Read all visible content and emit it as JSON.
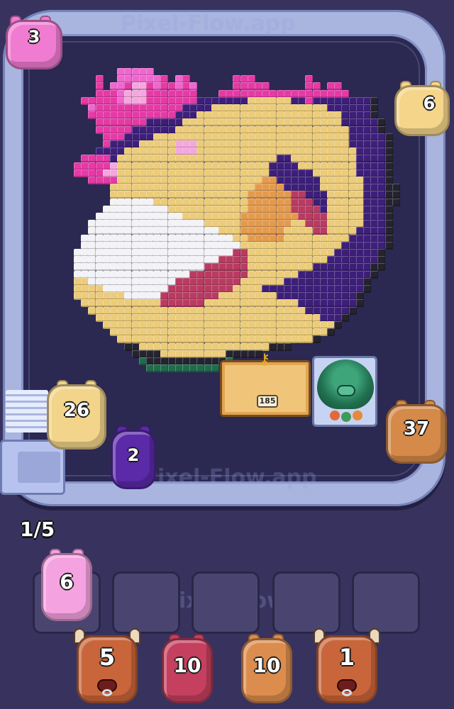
{
  "game": {
    "watermark_text": "Pixel-Flow.app",
    "queue_counter": "1/5",
    "key_box_count": "185"
  },
  "colors": {
    "background": "#38335e",
    "track": "#a9b5df",
    "board": "#2b2851"
  },
  "track_pigs": [
    {
      "name": "track-pig-pink",
      "number": "3",
      "color": "#f07cd2"
    },
    {
      "name": "track-pig-cream-right",
      "number": "6",
      "color": "#f4d58a"
    },
    {
      "name": "track-pig-cream-left",
      "number": "26",
      "color": "#f2d48a"
    },
    {
      "name": "track-pig-purple",
      "number": "2",
      "color": "#5a2aa8"
    },
    {
      "name": "track-pig-orange",
      "number": "37",
      "color": "#d58a4a"
    }
  ],
  "slot_pig": {
    "number": "6",
    "color": "#f5a2e0"
  },
  "bottom_pigs": [
    {
      "type": "bull",
      "number": "5",
      "color": "#c9653a"
    },
    {
      "type": "pig",
      "number": "10",
      "color": "#c4405e"
    },
    {
      "type": "pig",
      "number": "10",
      "color": "#dc8d4e"
    },
    {
      "type": "bull",
      "number": "1",
      "color": "#c9653a"
    }
  ],
  "slots": 5,
  "pixel_palette": {
    "p": "#f066cf",
    "P": "#e53aa6",
    "l": "#f4a7dd",
    "v": "#6a2fb0",
    "V": "#3d1f7a",
    "y": "#f6e39a",
    "Y": "#eccc7a",
    "w": "#f3f3f7",
    "o": "#e49a4d",
    "r": "#b93b62",
    "k": "#252330",
    "g": "#1e6c4a",
    "R": "#7a2a4c"
  },
  "pixel_art": [
    "......ppppp.....................................",
    "...P..ppppppP.pP......PPP.......P..............",
    "...P.ppPllPpPPpPp.....PPPPP.....PP.PP..........",
    "...PPPplllPPPPPPP...PPPPPPPPPPPPPPPPPP.........",
    ".PPPPPplllPPPPPPPVVVVVVVYYYYYYVVPVVVVVVVVk.....",
    "..pPPPPPPPPPPPPVVVVYYYYYYYYYYYYYYYYVVVVVVk.....",
    "..PPPPPPPPPPPPVVVYYYYYYYYYYYYYYYYYYYYVVVVk.....",
    "...PPPPPPPVVVVVYYYYYYYYYYYYYYYYYYYYYYVVVVVk....",
    "...PPPPPVVVVVVYYYYYYYYYYYYYYYYYYYYYYYYVVVVk....",
    "....PPPVVVVYYYYYYYYYYYYYYYYYYYYYYYYYYYVVVVVk...",
    "....PVVVVYYYYYlllYYYYYYYYYYYYYYYYYYYYYVVVVVk...",
    "...VVVVYYYYYYYlllYYYYYYYYYYYYYYYYYYYYYYVVVVk...",
    ".PPPPVYYYYYYYYYYYYYYYYYYYYYYVVYYYYYYYYYVVVVk...",
    "PPPPPlYYYYYYYYYYYYYYYYYYYYYVVVVYYYYYYYYVVVVk...",
    "PPPPllYYYYYYYYYYYYYYYYYYYYYVVVVVVYYYYYYVVVVk...",
    "..PPPPYYYYYYYYYYYYYYYYYYYYooVVVVVVYYYYYYVVVk...",
    ".....YYYYYYYYYYYYYYYYYYYYooooVVVVVYYYYYYVVVkk..",
    ".....YYYYYYYYYYYYYYYYYYYoooooorrVVVYYYYYVVVkk..",
    ".....wwwwwwYYYYYYYYYYYYYoooooorrrVVYYYYYVVVkk..",
    "....wwwwwwwwwYYYYYYYYYYYoooooorrrrVYYYYYVVVk...",
    "...wwwwwwwwwwwwYYYYYYYYoooooooorrrrYYYYYVVVk...",
    "..wwwwwwwwwwwwwwwwYYYYYoooooooYYrrrYYYYYVVVk...",
    "..wwwwwwwwwwwwwwwwwwYYYooooooYYYYrrYYYYVVVVk...",
    ".wwwwwwwwwwwwwwwwwwwwwYYoooooYYYYYYYYYVVVVVk...",
    ".wwwwwwwwwwwwwwwwwwwwwwYYYYYYYYYYYYYYVVVVVVk...",
    "wwwwwwwwwwwwwwwwwwwwwwrrYYYYYYYYYYYYVVVVVVk....",
    "wwwwwwwwwwwwwwwwwwwwrrrrYYYYYYYYYYYVVVVVVVk....",
    "wwwwwwwwwwwwwwwwwwrrrrrrYYYYYYYYYVVVVVVVVkk....",
    "wwwwwwwwwwwwwwwwrrrrrrrrYYYYYYYVVVVVVVVVVk.....",
    "YYwwwwwwwwwwwwrrrrrrrrrYYYYYYVVVVVVVVVVVk......",
    "YYYYwwwwwwwwwrrrrrrrrrYYYYVVVVVVVVVVVVVVk......",
    "YYYYYYYwwwwwrrrrrrrrYYYYYYYYVVVVVVVVVVVk.......",
    ".YYYYYYYYYYYrrrrrrYYYYYYYYYYYYYVVVVVVVVk.......",
    "..YYYYYYYYYYYYYYYYYYYYYYYYYYYYYYVVVVVVk........",
    "...YYYYYYYYYYYYYYYYYYYYYYYYYYYYYYYVVVk.........",
    "....YYYYYYYYYYYYYYYYYYYYYYYYYYYYYYYYk..........",
    ".....YYYYYYYYYYYYYYYYYYYYYYYYYYYYYYk...........",
    "......YYYYYYYYYYYYYYYYYYYYYYYYYYYk.............",
    ".......kkYYYYYYYYYYYYYYYYYYkkk.................",
    "........kkkkYYYYYYYYYkkkkk.....................",
    ".........gkkkkkkkkkkkg.........................",
    "..........gggggggggg..........................."
  ]
}
